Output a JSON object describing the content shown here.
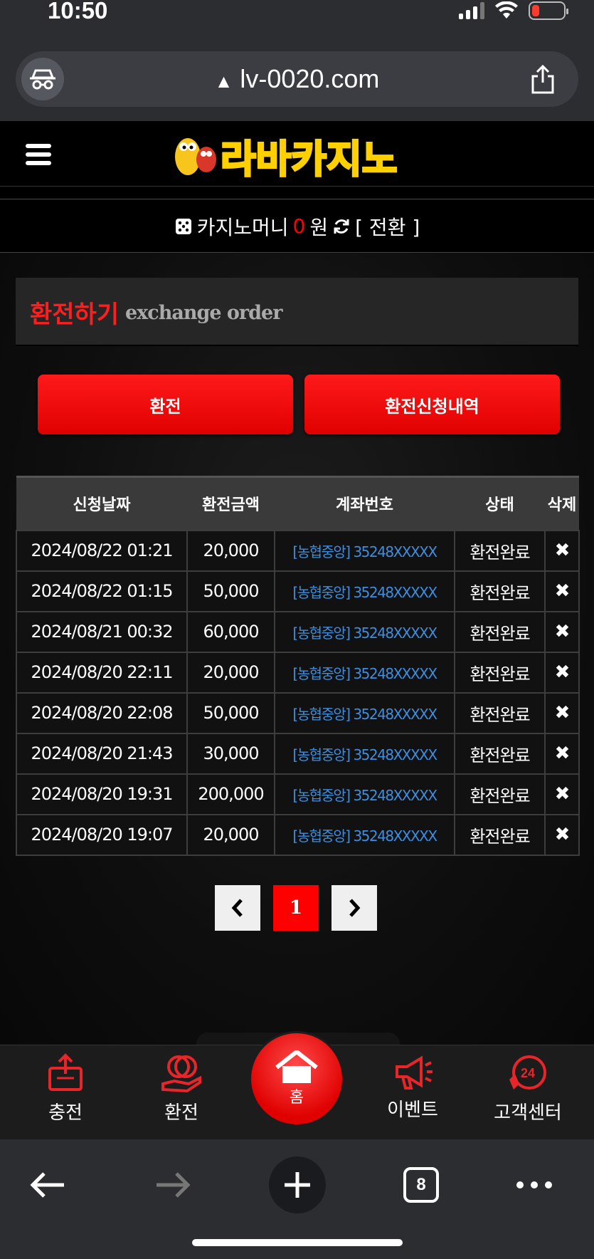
{
  "status_bar": {
    "time": "10:50"
  },
  "browser": {
    "url": "lv-0020.com",
    "tab_count": "8"
  },
  "site": {
    "logo_text": "라바카지노",
    "money_label": "카지노머니",
    "money_amount": "0",
    "money_unit": "원",
    "convert_label": "[ 전환 ]"
  },
  "section": {
    "title": "환전하기",
    "subtitle": "exchange order"
  },
  "buttons": {
    "exchange": "환전",
    "history": "환전신청내역"
  },
  "table": {
    "headers": [
      "신청날짜",
      "환전금액",
      "계좌번호",
      "상태",
      "삭제"
    ],
    "rows": [
      {
        "date": "2024/08/22 01:21",
        "amount": "20,000",
        "account": "[농협중앙] 35248XXXXX",
        "status": "환전완료"
      },
      {
        "date": "2024/08/22 01:15",
        "amount": "50,000",
        "account": "[농협중앙] 35248XXXXX",
        "status": "환전완료"
      },
      {
        "date": "2024/08/21 00:32",
        "amount": "60,000",
        "account": "[농협중앙] 35248XXXXX",
        "status": "환전완료"
      },
      {
        "date": "2024/08/20 22:11",
        "amount": "20,000",
        "account": "[농협중앙] 35248XXXXX",
        "status": "환전완료"
      },
      {
        "date": "2024/08/20 22:08",
        "amount": "50,000",
        "account": "[농협중앙] 35248XXXXX",
        "status": "환전완료"
      },
      {
        "date": "2024/08/20 21:43",
        "amount": "30,000",
        "account": "[농협중앙] 35248XXXXX",
        "status": "환전완료"
      },
      {
        "date": "2024/08/20 19:31",
        "amount": "200,000",
        "account": "[농협중앙] 35248XXXXX",
        "status": "환전완료"
      },
      {
        "date": "2024/08/20 19:07",
        "amount": "20,000",
        "account": "[농협중앙] 35248XXXXX",
        "status": "환전완료"
      }
    ],
    "delete_icon": "✖"
  },
  "pagination": {
    "prev": "‹",
    "current": "1",
    "next": "›"
  },
  "bottom_nav": {
    "deposit": "충전",
    "exchange": "환전",
    "home": "홈",
    "event": "이벤트",
    "support": "고객센터"
  },
  "colors": {
    "accent": "#ff0000",
    "account_link": "#3d8ee0"
  }
}
